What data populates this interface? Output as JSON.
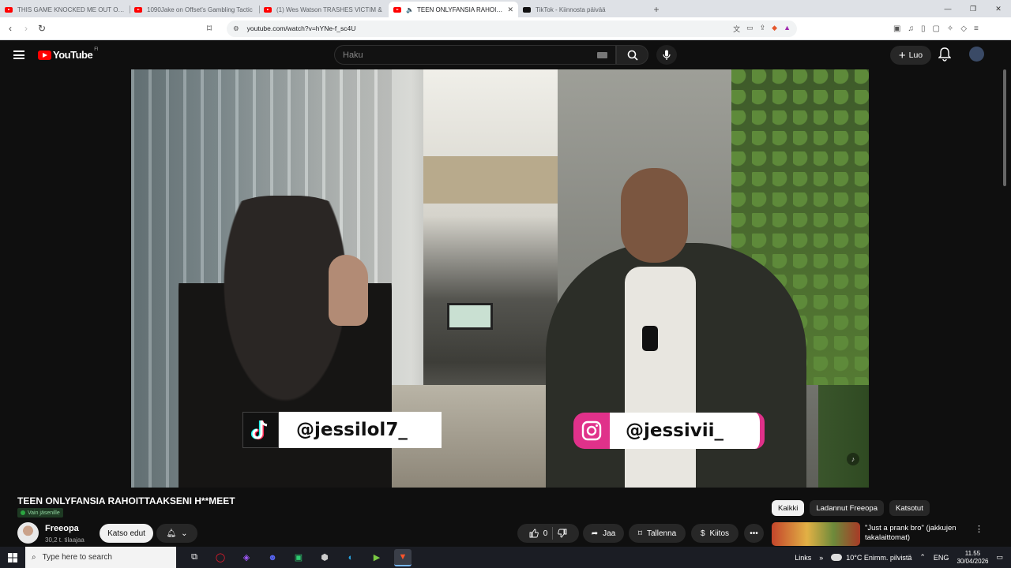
{
  "browser": {
    "tabs": [
      {
        "title": "THIS GAME KNOCKED ME OUT OF M",
        "icon": "youtube-icon",
        "active": false
      },
      {
        "title": "1090Jake on Offset's Gambling Tactic",
        "icon": "youtube-icon",
        "active": false
      },
      {
        "title": "(1) Wes Watson TRASHES VICTIM &",
        "icon": "youtube-icon",
        "active": false
      },
      {
        "title": "TEEN ONLYFANSIA RAHOITTA",
        "icon": "youtube-icon",
        "active": true
      },
      {
        "title": "TikTok - Kiinnosta päivää",
        "icon": "tiktok-icon",
        "active": false
      }
    ],
    "new_tab": "+",
    "url": "youtube.com/watch?v=hYNe-f_sc4U"
  },
  "youtube": {
    "logo_text": "YouTube",
    "country_code": "FI",
    "search_placeholder": "Haku",
    "create_label": "Luo"
  },
  "video": {
    "overlay_tiktok_handle": "@jessilol7_",
    "overlay_instagram_handle": "@jessivii_"
  },
  "details": {
    "title": "TEEN ONLYFANSIA RAHOITTAAKSENI H**MEET",
    "members_badge": "Vain jäsenille",
    "channel_name": "Freeopa",
    "subscribers": "30,2 t. tilaajaa",
    "join_label": "Katso edut",
    "like_count": "0",
    "share_label": "Jaa",
    "save_label": "Tallenna",
    "thanks_label": "Kiitos"
  },
  "sidebar": {
    "chips": [
      "Kaikki",
      "Ladannut Freeopa",
      "Katsotut"
    ],
    "selected_chip": "Kaikki",
    "recommendation_title": "\"Just a prank bro\" (jakkujen takalaittomat)"
  },
  "taskbar": {
    "search_placeholder": "Type here to search",
    "links_label": "Links",
    "weather": "10°C  Enimm. pilvistä",
    "language": "ENG",
    "time": "11.55",
    "date": "30/04/2026"
  },
  "colors": {
    "youtube_red": "#ff0000",
    "instagram_pink": "#e0318a",
    "background": "#0f0f0f"
  }
}
